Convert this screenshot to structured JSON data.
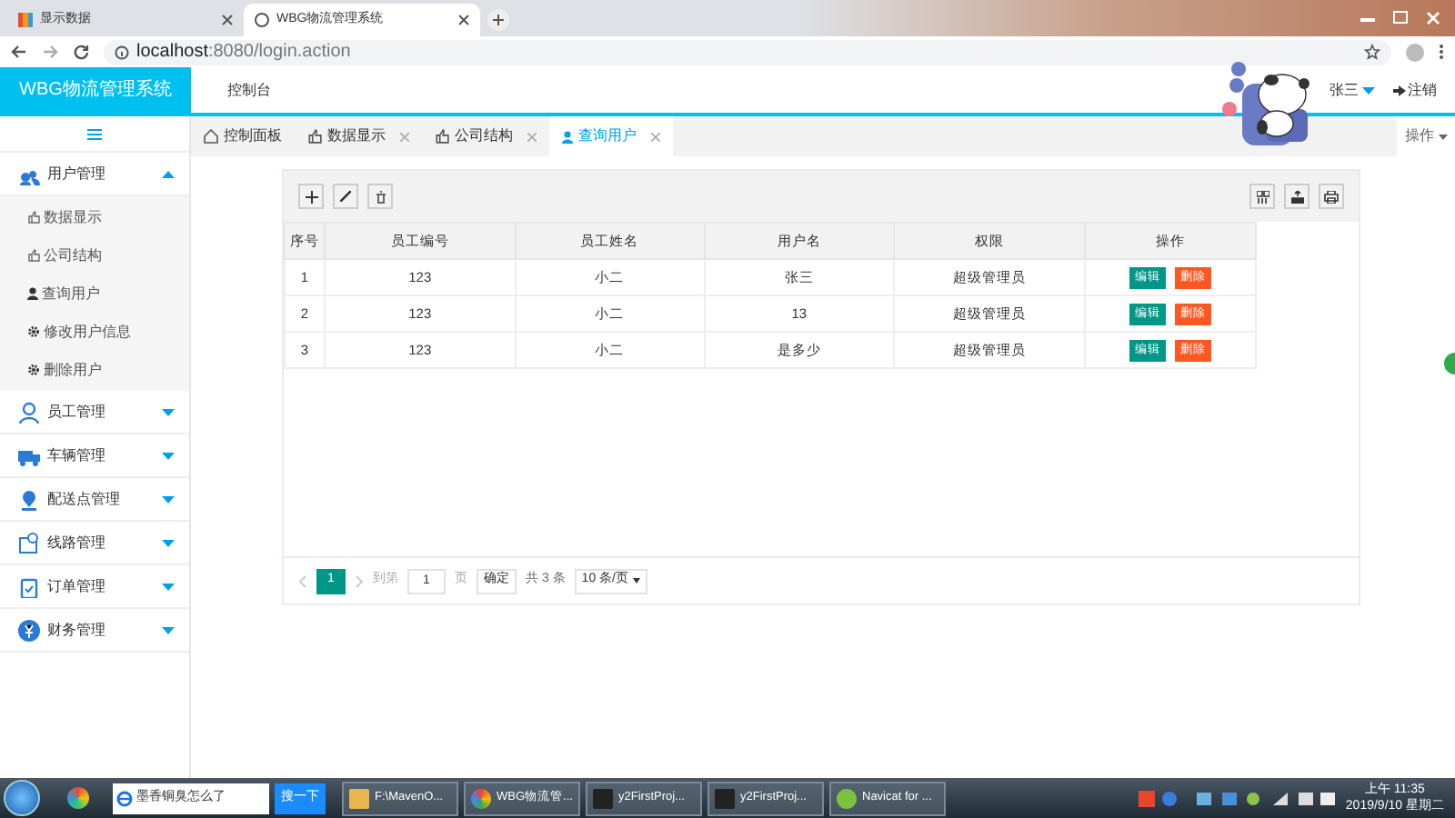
{
  "browser": {
    "tabs": [
      {
        "title": "显示数据",
        "selected": false
      },
      {
        "title": "WBG物流管理系统",
        "selected": true
      }
    ],
    "address_host": "localhost",
    "address_rest": ":8080/login.action"
  },
  "header": {
    "brand": "WBG物流管理系统",
    "nav": "控制台",
    "user": "张三",
    "logout": "注销"
  },
  "sidebar": {
    "items": [
      {
        "label": "用户管理",
        "expanded": true,
        "children": [
          {
            "label": "数据显示"
          },
          {
            "label": "公司结构"
          },
          {
            "label": "查询用户"
          },
          {
            "label": "修改用户信息"
          },
          {
            "label": "删除用户"
          }
        ]
      },
      {
        "label": "员工管理",
        "expanded": false
      },
      {
        "label": "车辆管理",
        "expanded": false
      },
      {
        "label": "配送点管理",
        "expanded": false
      },
      {
        "label": "线路管理",
        "expanded": false
      },
      {
        "label": "订单管理",
        "expanded": false
      },
      {
        "label": "财务管理",
        "expanded": false
      }
    ]
  },
  "page_tabs": [
    {
      "label": "控制面板",
      "closable": false,
      "selected": false
    },
    {
      "label": "数据显示",
      "closable": true,
      "selected": false
    },
    {
      "label": "公司结构",
      "closable": true,
      "selected": false
    },
    {
      "label": "查询用户",
      "closable": true,
      "selected": true
    }
  ],
  "tabs_menu": "操作",
  "table": {
    "columns": [
      "序号",
      "员工编号",
      "员工姓名",
      "用户名",
      "权限",
      "操作"
    ],
    "rows": [
      {
        "cells": [
          "1",
          "123",
          "小二",
          "张三",
          "超级管理员"
        ],
        "actions": [
          "编辑",
          "删除"
        ]
      },
      {
        "cells": [
          "2",
          "123",
          "小二",
          "13",
          "超级管理员"
        ],
        "actions": [
          "编辑",
          "删除"
        ]
      },
      {
        "cells": [
          "3",
          "123",
          "小二",
          "是多少",
          "超级管理员"
        ],
        "actions": [
          "编辑",
          "删除"
        ]
      }
    ]
  },
  "pagination": {
    "page": "1",
    "goto_label": "到第",
    "goto_value": "1",
    "page_unit": "页",
    "confirm": "确定",
    "total": "共 3 条",
    "page_size": "10 条/页"
  },
  "taskbar": {
    "search": "墨香铜臭怎么了",
    "search_button": "搜一下",
    "tasks": [
      "F:\\MavenO...",
      "WBG物流管...",
      "y2FirstProj...",
      "y2FirstProj...",
      "Navicat for ..."
    ],
    "time": "上午 11:35",
    "date": "2019/9/10 星期二"
  }
}
